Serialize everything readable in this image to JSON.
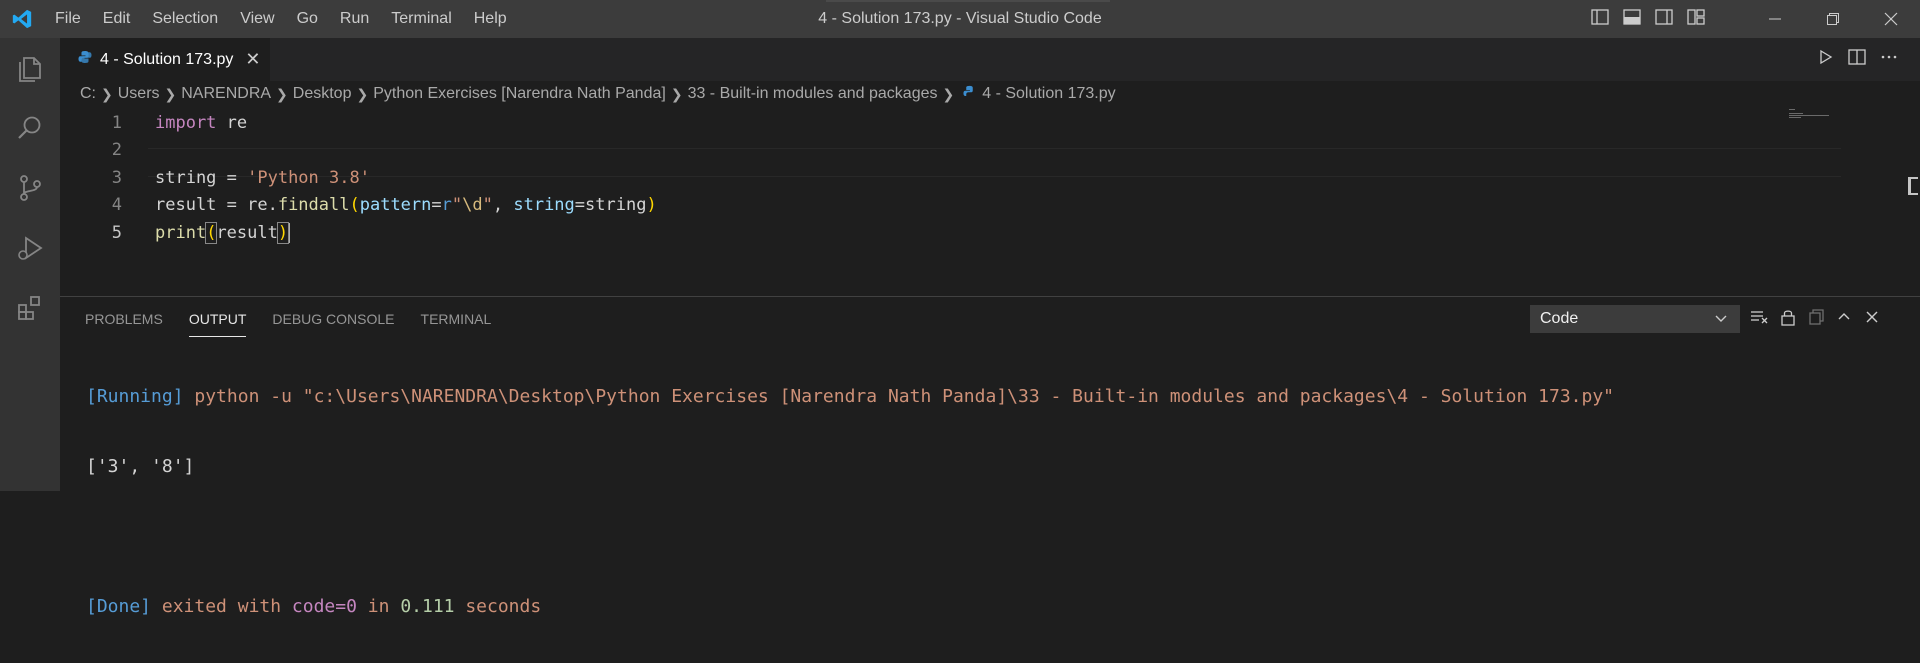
{
  "window": {
    "title": "4 - Solution 173.py - Visual Studio Code",
    "menu": [
      "File",
      "Edit",
      "Selection",
      "View",
      "Go",
      "Run",
      "Terminal",
      "Help"
    ]
  },
  "editor": {
    "tab": {
      "label": "4 - Solution 173.py",
      "close": "✕"
    },
    "breadcrumb": [
      "C:",
      "Users",
      "NARENDRA",
      "Desktop",
      "Python Exercises [Narendra Nath Panda]",
      "33 - Built-in modules and packages",
      "4 - Solution 173.py"
    ],
    "line_numbers": [
      "1",
      "2",
      "3",
      "4",
      "5"
    ],
    "code": {
      "l1_kw": "import",
      "l1_rest": " re",
      "l3_var": "string = ",
      "l3_str": "'Python 3.8'",
      "l4_a": "result = re.",
      "l4_fn": "findall",
      "l4_p1": "pattern",
      "l4_eq1": "=",
      "l4_r": "r",
      "l4_q1": "\"",
      "l4_esc": "\\d",
      "l4_q2": "\"",
      "l4_comma": ", ",
      "l4_p2": "string",
      "l4_eq2": "=string",
      "l5_fn": "print",
      "l5_arg": "result"
    }
  },
  "panel": {
    "tabs": [
      "PROBLEMS",
      "OUTPUT",
      "DEBUG CONSOLE",
      "TERMINAL"
    ],
    "active_tab": "OUTPUT",
    "select_value": "Code",
    "output": {
      "running_tag": "[Running]",
      "running_cmd": " python -u \"c:\\Users\\NARENDRA\\Desktop\\Python Exercises [Narendra Nath Panda]\\33 - Built-in modules and packages\\4 - Solution 173.py\"",
      "result": "['3', '8']",
      "done_tag": "[Done]",
      "done_a": " exited with ",
      "done_code": "code=0",
      "done_b": " in ",
      "done_time": "0.111",
      "done_c": " seconds"
    }
  },
  "colors": {
    "titlebar": "#3c3c3c",
    "activitybar": "#333333",
    "editor_bg": "#1e1e1e",
    "accent": "#007acc"
  },
  "icons": [
    "vscode-logo-icon",
    "explorer-icon",
    "search-icon",
    "source-control-icon",
    "run-debug-icon",
    "extensions-icon",
    "python-file-icon",
    "run-file-icon",
    "split-editor-icon",
    "more-actions-icon"
  ]
}
